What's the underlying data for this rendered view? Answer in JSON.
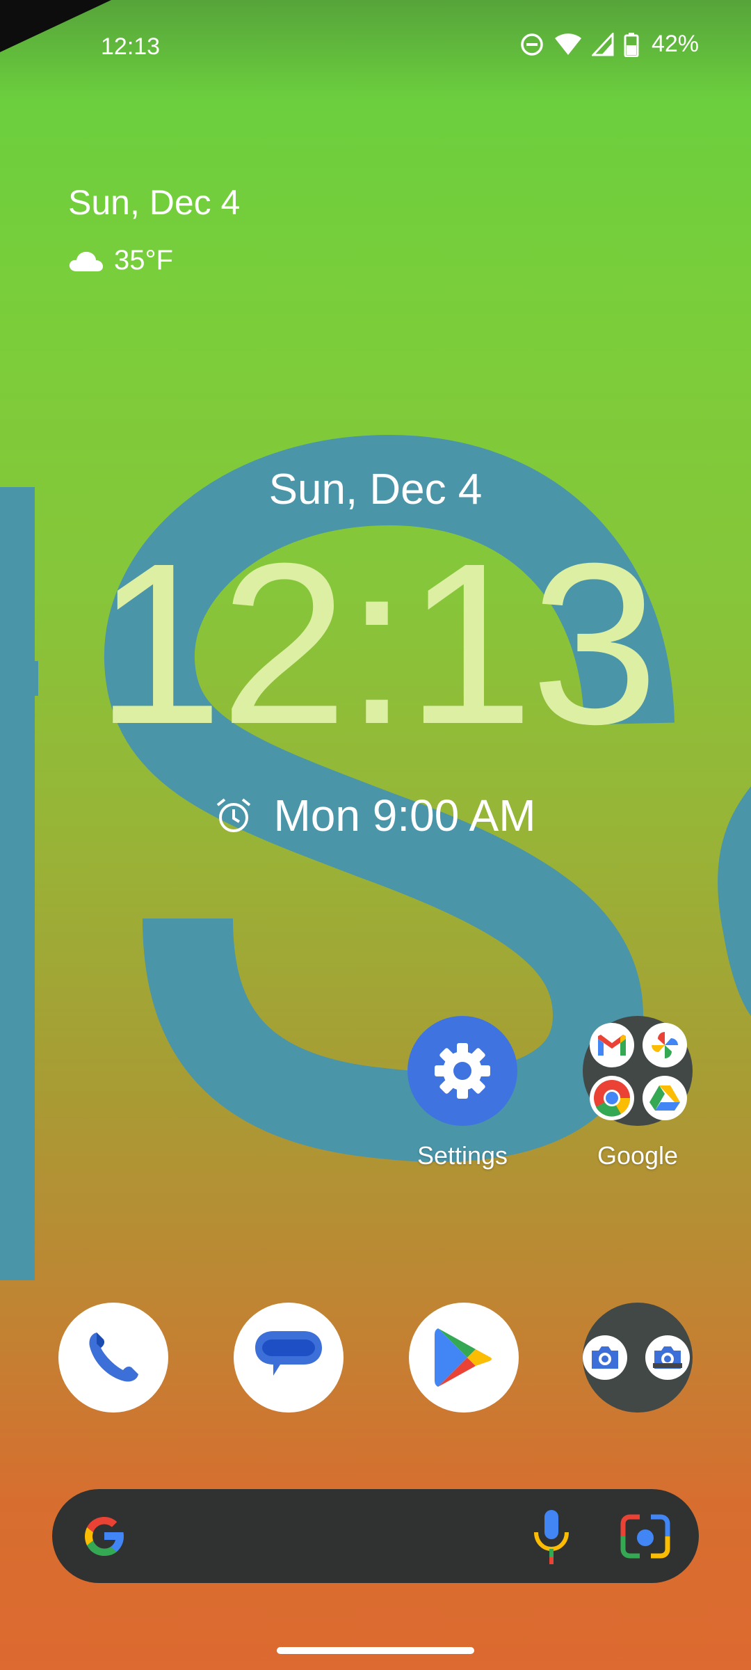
{
  "status_bar": {
    "time": "12:13",
    "battery": "42%"
  },
  "glance": {
    "date": "Sun, Dec 4",
    "weather": "35°F",
    "weather_icon": "cloud-icon"
  },
  "clock": {
    "date": "Sun, Dec 4",
    "time": "12:13",
    "alarm": "Mon 9:00 AM"
  },
  "home_apps": [
    {
      "label": "Settings",
      "icon": "gear-icon"
    },
    {
      "label": "Google",
      "icon": "folder-icon"
    }
  ],
  "dock": [
    {
      "name": "phone",
      "icon": "phone-icon"
    },
    {
      "name": "messages",
      "icon": "message-icon"
    },
    {
      "name": "play-store",
      "icon": "play-store-icon"
    },
    {
      "name": "camera-folder",
      "icon": "camera-icon"
    }
  ],
  "colors": {
    "clock": "#dcefa3",
    "settings": "#3f74e0",
    "folder": "#414845",
    "search_bar": "#2f3231"
  }
}
